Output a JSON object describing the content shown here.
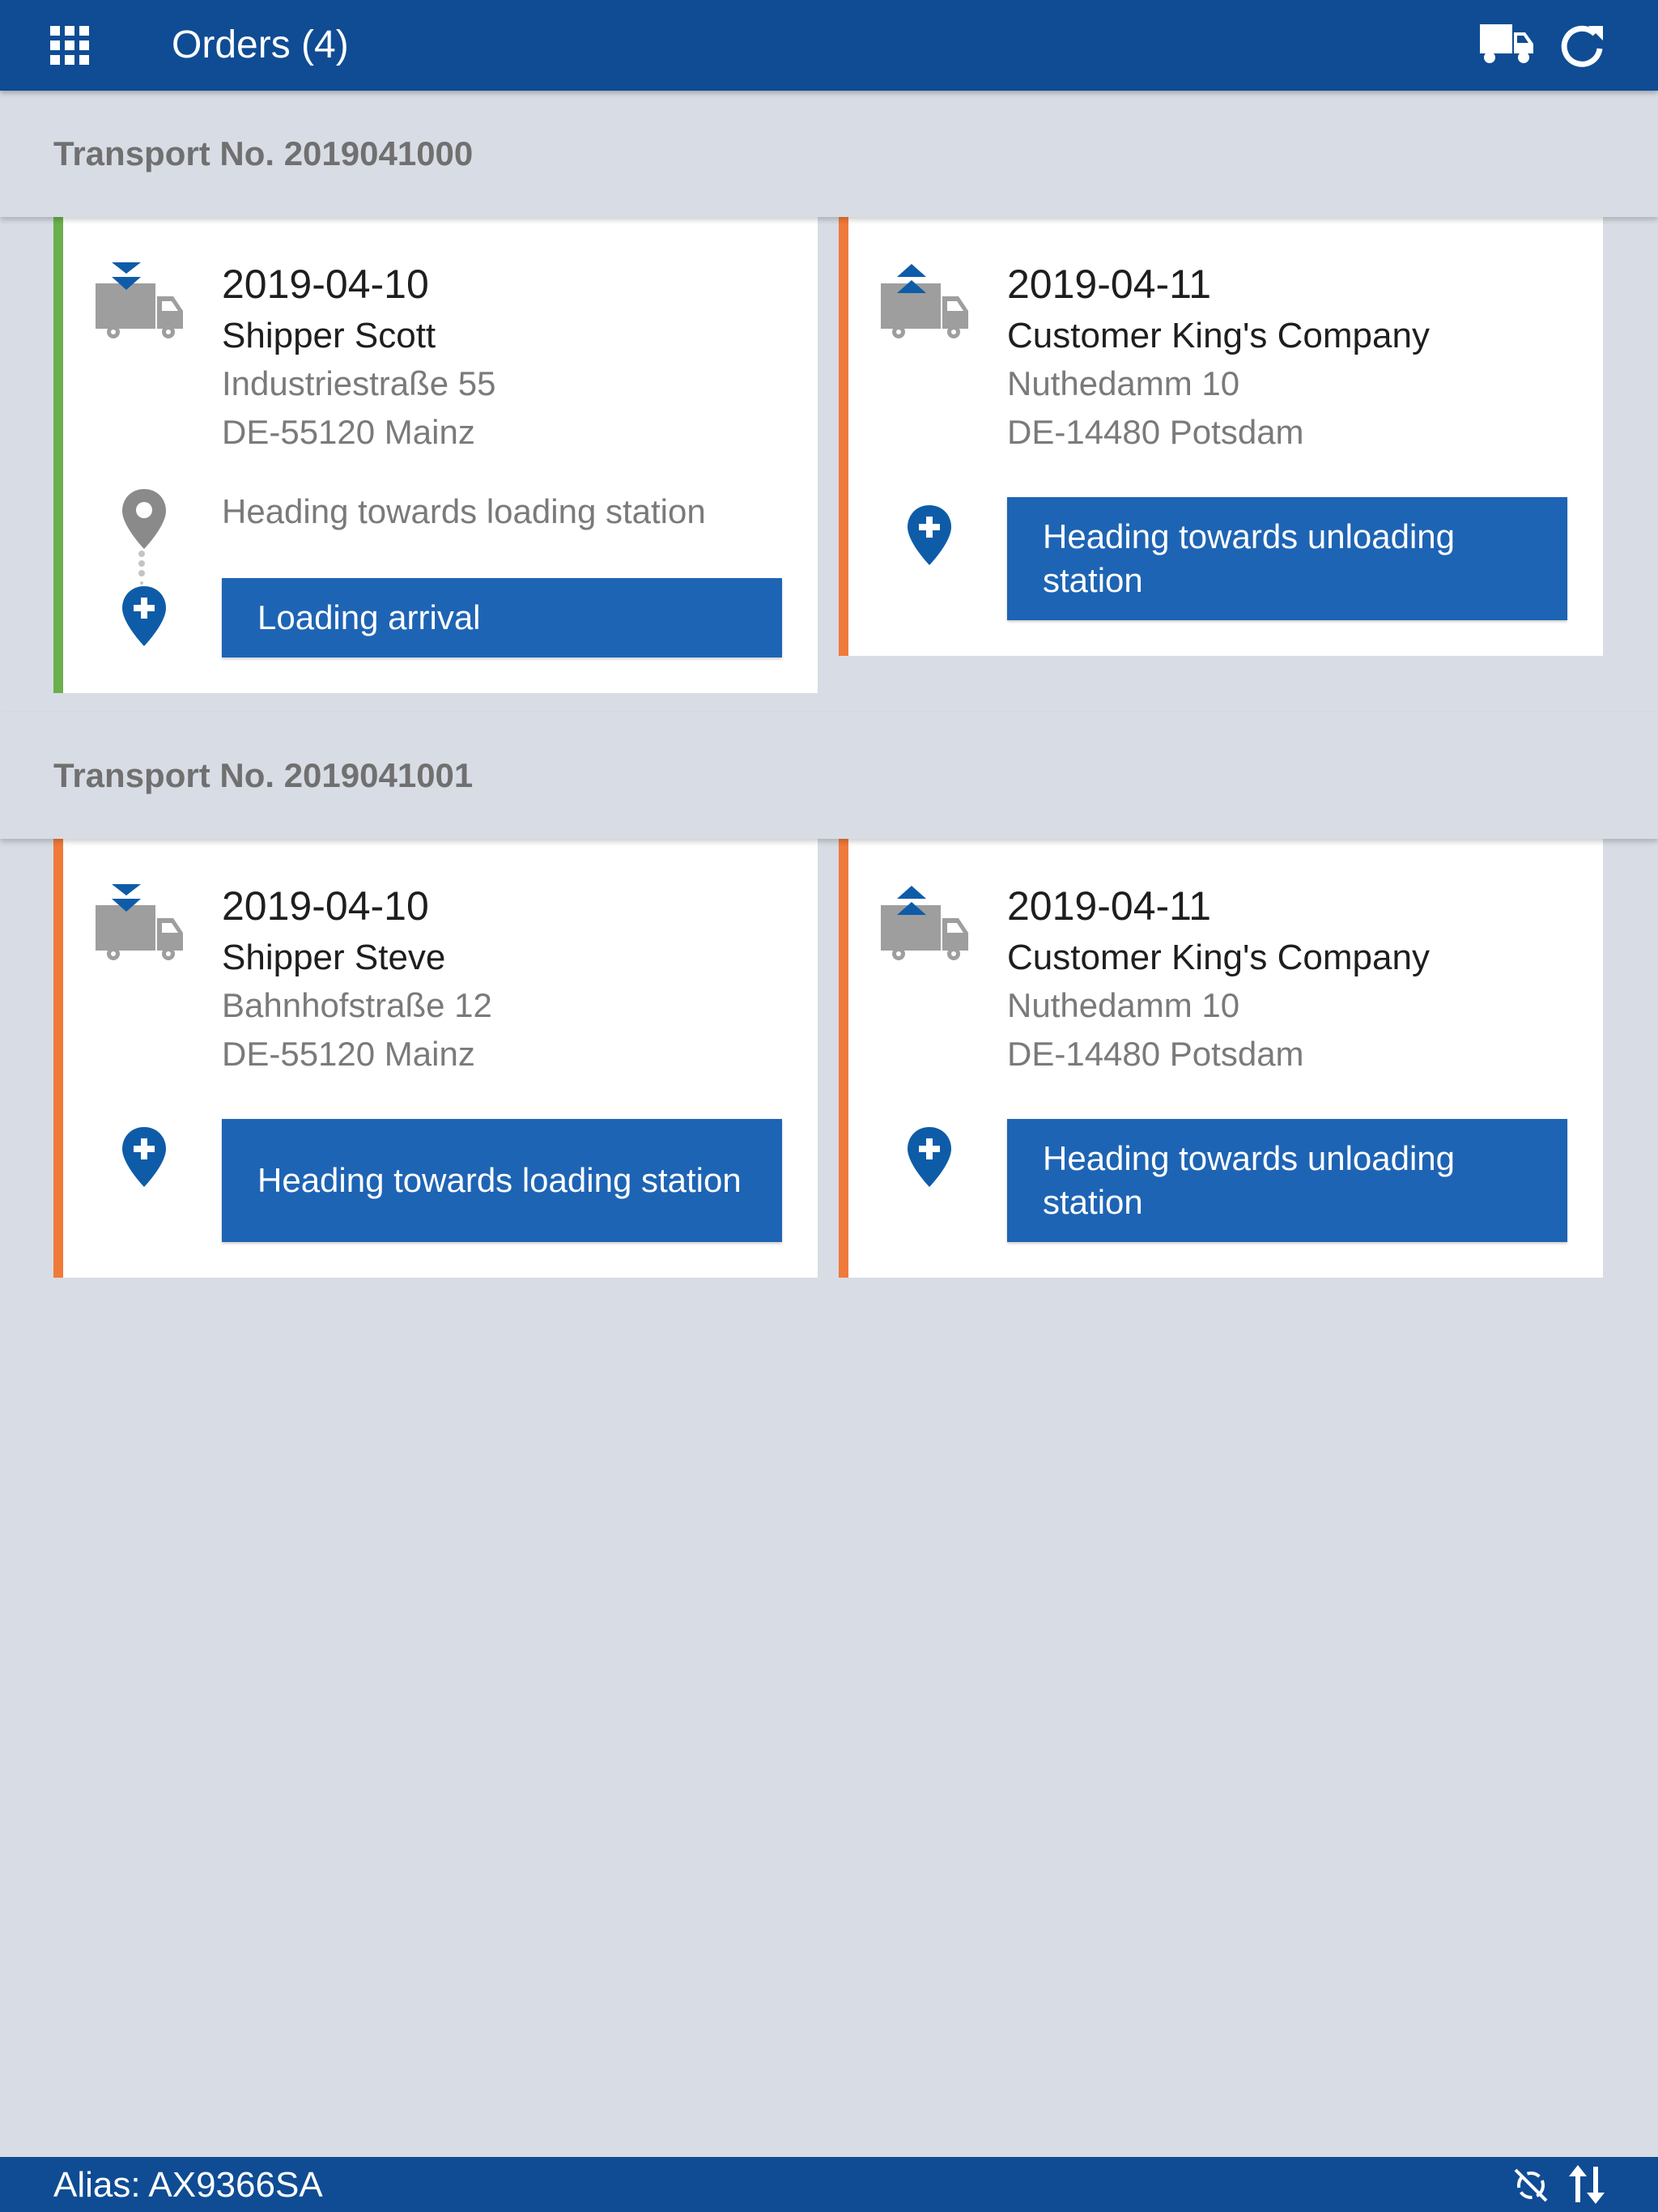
{
  "appbar": {
    "title": "Orders (4)",
    "icons": [
      "apps-grid-icon",
      "truck-icon",
      "refresh-icon"
    ]
  },
  "colors": {
    "primary": "#0f4c94",
    "button": "#1e64b4",
    "stripe_done": "#6ab04c",
    "stripe_pending": "#f07a3a",
    "pin": "#0e5ca8",
    "background": "#d8dce4"
  },
  "transports": [
    {
      "header": "Transport No. 2019041000",
      "stops": [
        {
          "type": "loading",
          "stripe": "green",
          "date": "2019-04-10",
          "name": "Shipper Scott",
          "street": "Industriestraße 55",
          "city": "DE-55120 Mainz",
          "status_text": "Heading towards loading station",
          "action": "Loading arrival"
        },
        {
          "type": "unloading",
          "stripe": "orange",
          "date": "2019-04-11",
          "name": "Customer King's Company",
          "street": "Nuthedamm 10",
          "city": "DE-14480 Potsdam",
          "action": "Heading towards unloading station"
        }
      ]
    },
    {
      "header": "Transport No. 2019041001",
      "stops": [
        {
          "type": "loading",
          "stripe": "orange",
          "date": "2019-04-10",
          "name": "Shipper Steve",
          "street": "Bahnhofstraße 12",
          "city": "DE-55120 Mainz",
          "action": "Heading towards loading station"
        },
        {
          "type": "unloading",
          "stripe": "orange",
          "date": "2019-04-11",
          "name": "Customer King's Company",
          "street": "Nuthedamm 10",
          "city": "DE-14480 Potsdam",
          "action": "Heading towards unloading station"
        }
      ]
    }
  ],
  "statusbar": {
    "alias": "Alias: AX9366SA",
    "icons": [
      "sync-off-icon",
      "transfer-arrows-icon"
    ]
  }
}
